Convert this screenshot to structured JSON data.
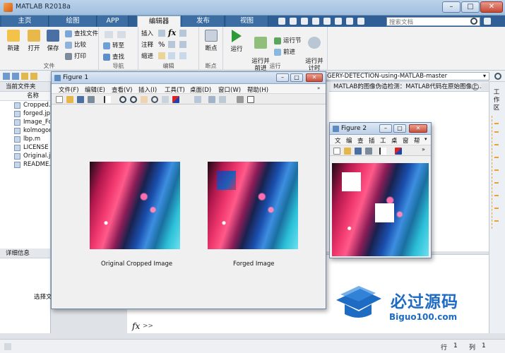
{
  "app": {
    "title": "MATLAB R2018a",
    "window_buttons": [
      "–",
      "□",
      "✕"
    ]
  },
  "tabs": [
    {
      "label": "主页"
    },
    {
      "label": "绘图"
    },
    {
      "label": "APP"
    },
    {
      "label": "编辑器",
      "active": true
    },
    {
      "label": "发布"
    },
    {
      "label": "视图"
    }
  ],
  "search": {
    "placeholder": "搜索文档"
  },
  "ribbon": {
    "file": {
      "label": "文件",
      "new": "新建",
      "open": "打开",
      "save": "保存",
      "find_files": "查找文件",
      "compare": "比较",
      "print": "打印"
    },
    "navigate": {
      "label": "导航",
      "goto": "转至",
      "find": "查找"
    },
    "edit": {
      "label": "编辑",
      "insert": "插入",
      "comment": "注释",
      "indent": "缩进",
      "fx": "fx"
    },
    "breakpoints": {
      "label": "断点",
      "breakpoints": "断点"
    },
    "run": {
      "label": "运行",
      "run": "运行",
      "run_advance": "运行并\n前进",
      "run_section": "运行节",
      "advance": "前进",
      "run_time": "运行并\n计时"
    }
  },
  "address": {
    "path_tail": "GERY-DETECTION-using-MATLAB-master"
  },
  "folder_panel": {
    "title": "当前文件夹",
    "column": "名称",
    "files": [
      "Cropped.jp",
      "forged.jpg",
      "Image_Fo",
      "kolmogor",
      "lbp.m",
      "LICENSE",
      "Original.jp",
      "README.m"
    ]
  },
  "detail_panel": {
    "title": "详细信息",
    "message": "选择文"
  },
  "editor_tab": {
    "label": "MATLAB的图像伪造检测：MATLAB代码在原始图像上..."
  },
  "command_window": {
    "fx": "fx",
    "prompt": ">>"
  },
  "right_strip": {
    "label": "工作区"
  },
  "status": {
    "row_label": "行",
    "row": "1",
    "col_label": "列",
    "col": "1"
  },
  "figure1": {
    "title": "Figure 1",
    "menu": [
      "文件(F)",
      "编辑(E)",
      "查看(V)",
      "插入(I)",
      "工具(T)",
      "桌面(D)",
      "窗口(W)",
      "帮助(H)"
    ],
    "captions": [
      "Original Cropped Image",
      "Forged Image"
    ]
  },
  "figure2": {
    "title": "Figure 2",
    "menu": [
      "文",
      "编",
      "查",
      "插",
      "工",
      "桌",
      "窗",
      "帮"
    ]
  },
  "watermark": {
    "line1": "必过源码",
    "line2": "Biguo100.com"
  },
  "colors": {
    "ribbon_tab_bg": "#2f5f94",
    "accent_blue": "#1e6bc4",
    "close_red": "#c64a36"
  }
}
